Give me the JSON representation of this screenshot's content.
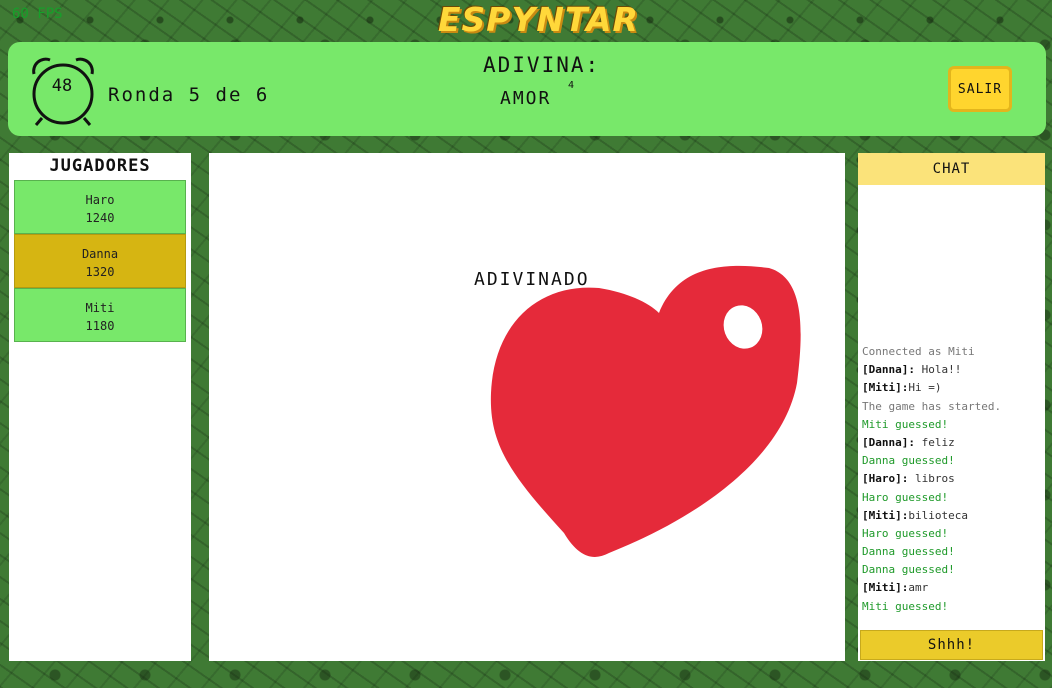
{
  "fps": "60 FPS",
  "logo": "ESPYNTAR",
  "topbar": {
    "timer": "48",
    "round": "Ronda 5 de 6",
    "guess_title": "ADIVINA:",
    "word": "AMOR",
    "word_length": "4",
    "exit_label": "SALIR"
  },
  "players": {
    "title": "JUGADORES",
    "list": [
      {
        "name": "Haro",
        "score": "1240"
      },
      {
        "name": "Danna",
        "score": "1320"
      },
      {
        "name": "Miti",
        "score": "1180"
      }
    ]
  },
  "canvas": {
    "status": "ADIVINADO",
    "drawing_color": "#e52a3a"
  },
  "chat": {
    "title": "CHAT",
    "messages": [
      {
        "type": "system",
        "text": "Connected as Miti"
      },
      {
        "type": "user",
        "author": "[Danna]:",
        "text": " Hola!!"
      },
      {
        "type": "user",
        "author": "[Miti]:",
        "text": "Hi =)"
      },
      {
        "type": "system",
        "text": "The game has started."
      },
      {
        "type": "guess",
        "text": "Miti guessed!"
      },
      {
        "type": "user",
        "author": "[Danna]:",
        "text": " feliz"
      },
      {
        "type": "guess",
        "text": "Danna guessed!"
      },
      {
        "type": "user",
        "author": "[Haro]:",
        "text": " libros"
      },
      {
        "type": "guess",
        "text": "Haro guessed!"
      },
      {
        "type": "user",
        "author": "[Miti]:",
        "text": "bilioteca"
      },
      {
        "type": "guess",
        "text": "Haro guessed!"
      },
      {
        "type": "guess",
        "text": "Danna guessed!"
      },
      {
        "type": "guess",
        "text": "Danna guessed!"
      },
      {
        "type": "user",
        "author": "[Miti]:",
        "text": "amr"
      },
      {
        "type": "guess",
        "text": "Miti guessed!"
      }
    ],
    "input_placeholder": "Shhh!"
  }
}
